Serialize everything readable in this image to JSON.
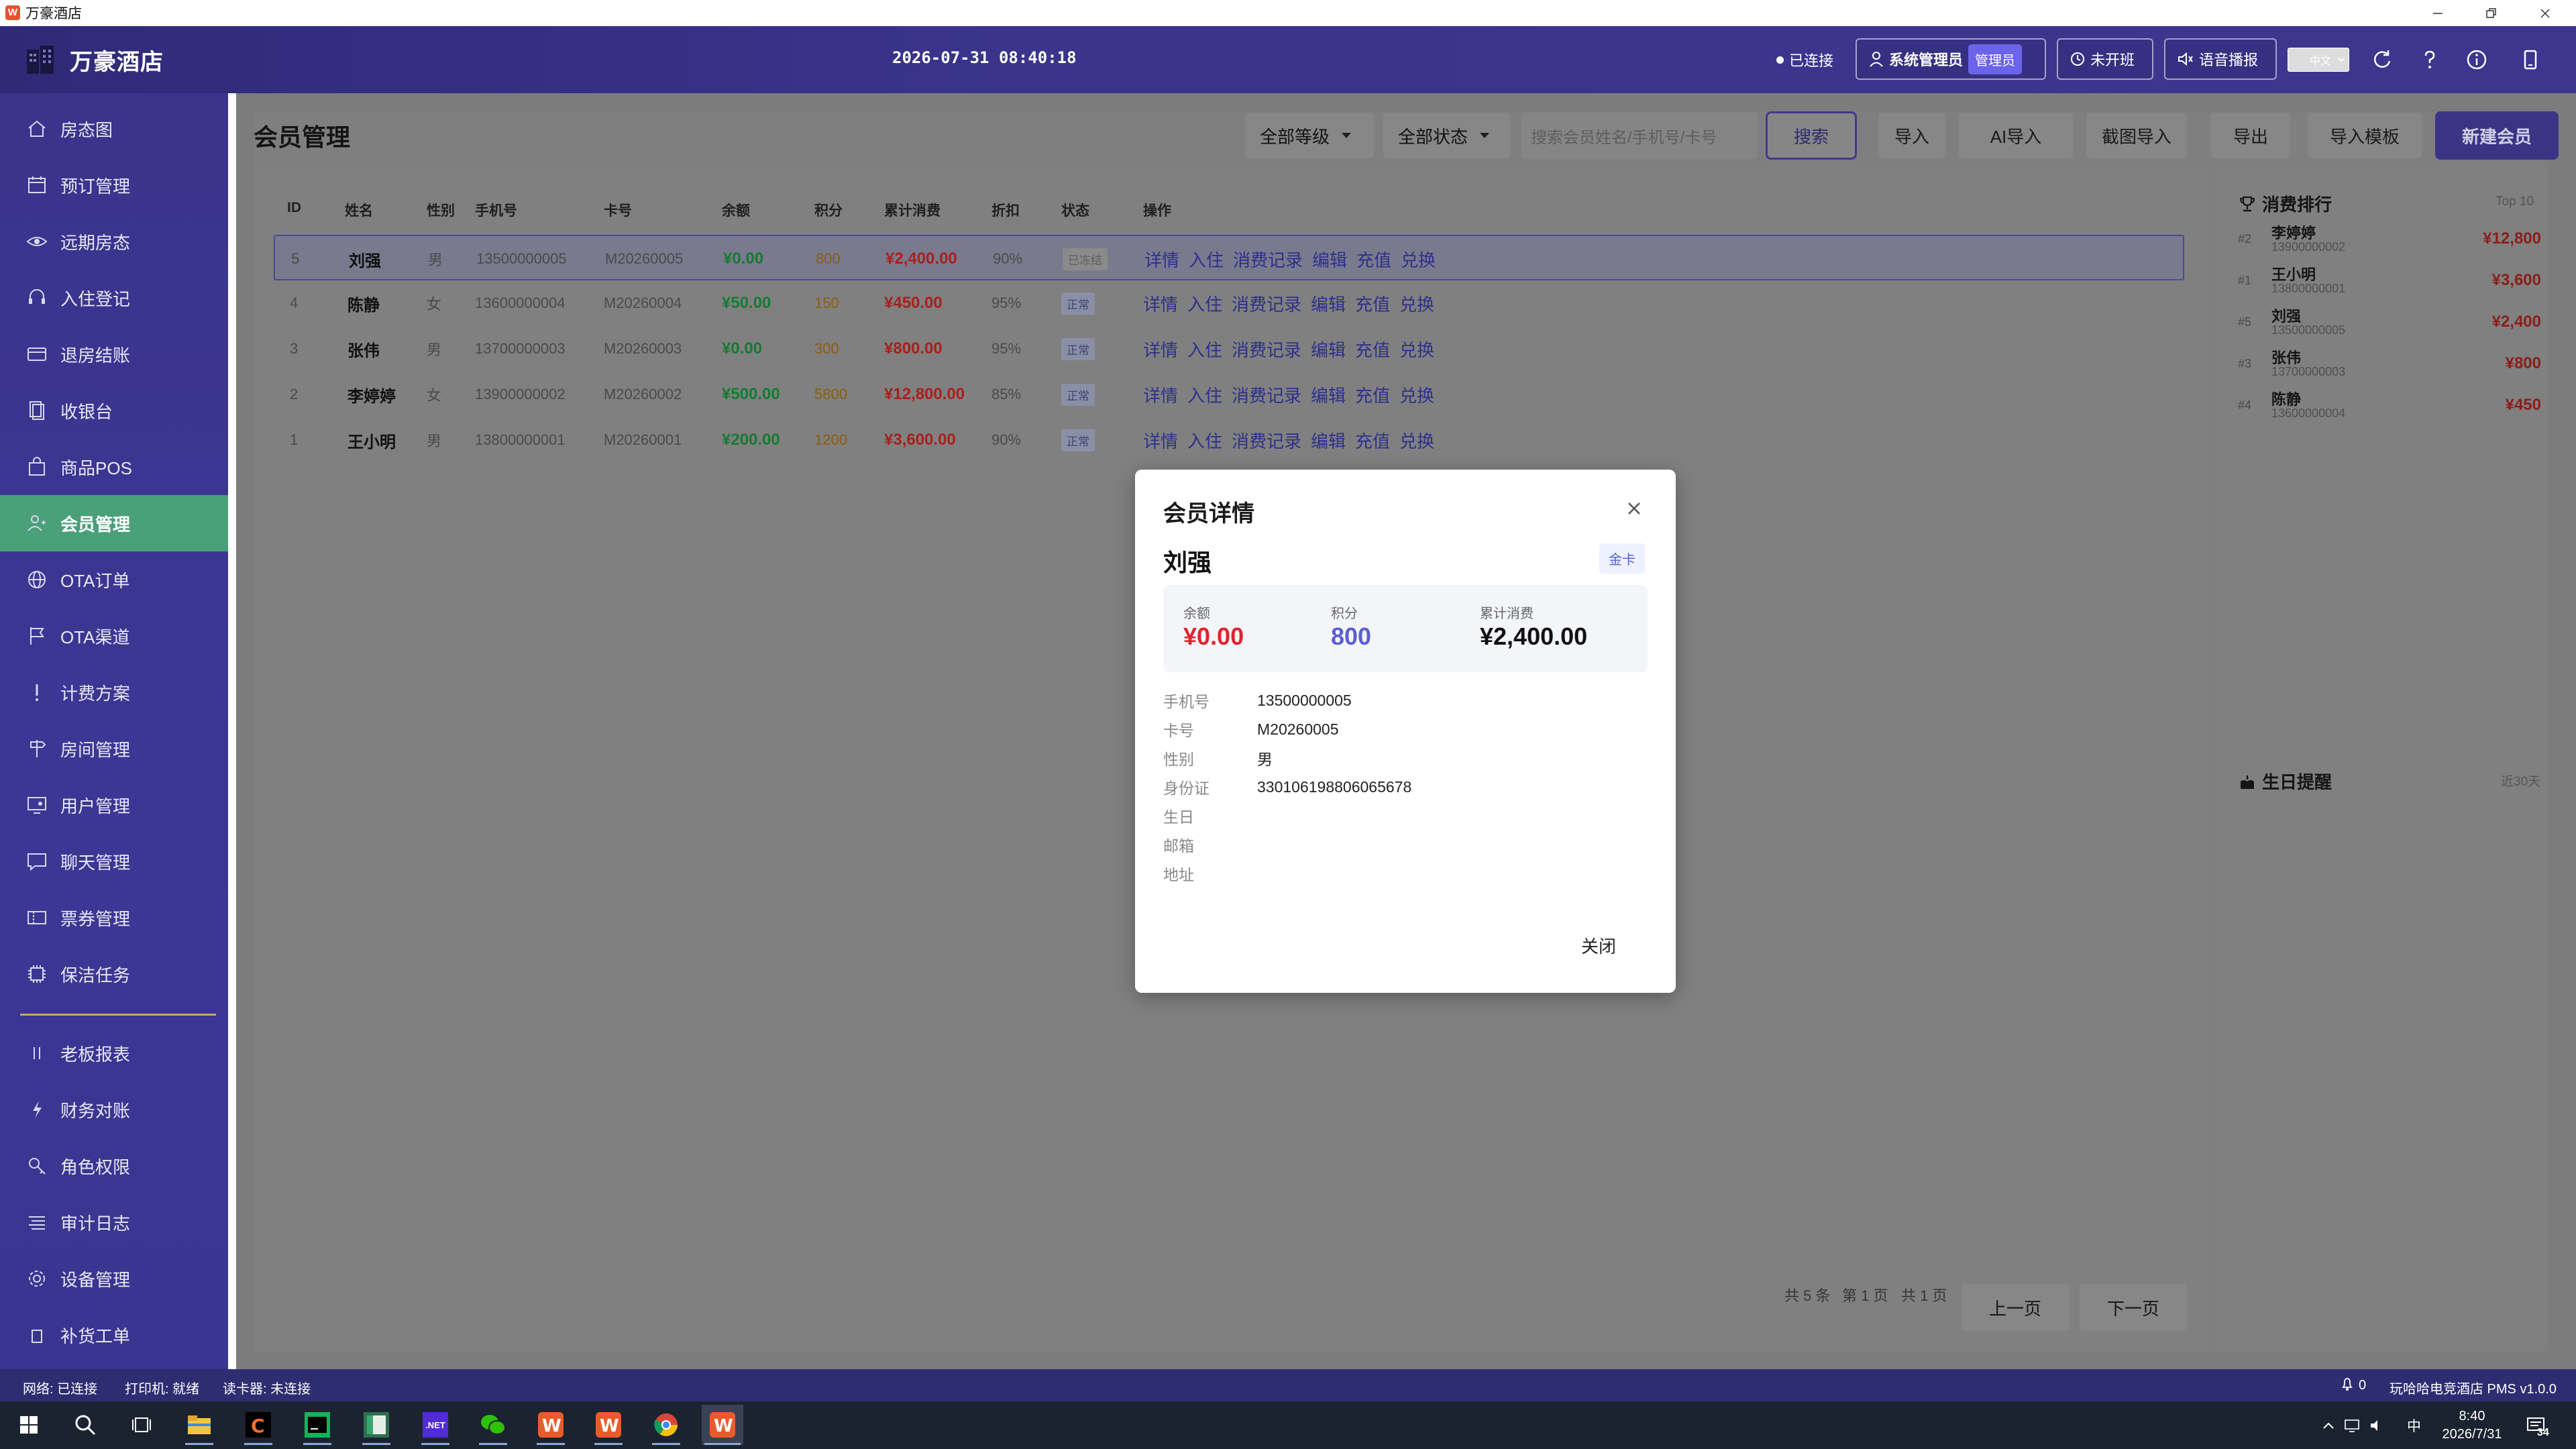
{
  "window": {
    "title": "万豪酒店"
  },
  "header": {
    "brand": "万豪酒店",
    "datetime": "2026-07-31 08:40:18",
    "connection": "已连接",
    "user_label": "系统管理员",
    "role_badge": "管理员",
    "shift_label": "未开班",
    "voice_label": "语音播报",
    "lang_value": "中文"
  },
  "sidebar": {
    "items": [
      {
        "label": "房态图",
        "icon": "home-icon"
      },
      {
        "label": "预订管理",
        "icon": "calendar-icon"
      },
      {
        "label": "远期房态",
        "icon": "eye-icon"
      },
      {
        "label": "入住登记",
        "icon": "headset-icon"
      },
      {
        "label": "退房结账",
        "icon": "card-icon"
      },
      {
        "label": "收银台",
        "icon": "cashier-icon"
      },
      {
        "label": "商品POS",
        "icon": "bag-icon"
      },
      {
        "label": "会员管理",
        "icon": "members-icon"
      },
      {
        "label": "OTA订单",
        "icon": "globe-icon"
      },
      {
        "label": "OTA渠道",
        "icon": "flag-icon"
      },
      {
        "label": "计费方案",
        "icon": "exclamation-icon"
      },
      {
        "label": "房间管理",
        "icon": "signpost-icon"
      },
      {
        "label": "用户管理",
        "icon": "monitor-user-icon"
      },
      {
        "label": "聊天管理",
        "icon": "chat-icon"
      },
      {
        "label": "票券管理",
        "icon": "ticket-icon"
      },
      {
        "label": "保洁任务",
        "icon": "chip-icon"
      },
      {
        "label": "老板报表",
        "icon": "bars-icon"
      },
      {
        "label": "财务对账",
        "icon": "lightning-icon"
      },
      {
        "label": "角色权限",
        "icon": "key-icon"
      },
      {
        "label": "审计日志",
        "icon": "list-icon"
      },
      {
        "label": "设备管理",
        "icon": "gear-icon"
      },
      {
        "label": "补货工单",
        "icon": "box-icon"
      }
    ],
    "active_index": 7
  },
  "page": {
    "title": "会员管理",
    "level_filter": "全部等级",
    "status_filter": "全部状态",
    "search_placeholder": "搜索会员姓名/手机号/卡号",
    "search_button": "搜索",
    "import_button": "导入",
    "ai_import_button": "AI导入",
    "screenshot_import_button": "截图导入",
    "export_button": "导出",
    "template_button": "导入模板",
    "new_button": "新建会员"
  },
  "table": {
    "headers": [
      "ID",
      "姓名",
      "性别",
      "手机号",
      "卡号",
      "余额",
      "积分",
      "累计消费",
      "折扣",
      "状态",
      "操作"
    ],
    "actions": [
      "详情",
      "入住",
      "消费记录",
      "编辑",
      "充值",
      "兑换"
    ],
    "rows": [
      {
        "id": "5",
        "name": "刘强",
        "gender": "男",
        "phone": "13500000005",
        "card": "M20260005",
        "balance": "¥0.00",
        "points": "800",
        "total": "¥2,400.00",
        "discount": "90%",
        "status": "已冻结"
      },
      {
        "id": "4",
        "name": "陈静",
        "gender": "女",
        "phone": "13600000004",
        "card": "M20260004",
        "balance": "¥50.00",
        "points": "150",
        "total": "¥450.00",
        "discount": "95%",
        "status": "正常"
      },
      {
        "id": "3",
        "name": "张伟",
        "gender": "男",
        "phone": "13700000003",
        "card": "M20260003",
        "balance": "¥0.00",
        "points": "300",
        "total": "¥800.00",
        "discount": "95%",
        "status": "正常"
      },
      {
        "id": "2",
        "name": "李婷婷",
        "gender": "女",
        "phone": "13900000002",
        "card": "M20260002",
        "balance": "¥500.00",
        "points": "5800",
        "total": "¥12,800.00",
        "discount": "85%",
        "status": "正常"
      },
      {
        "id": "1",
        "name": "王小明",
        "gender": "男",
        "phone": "13800000001",
        "card": "M20260001",
        "balance": "¥200.00",
        "points": "1200",
        "total": "¥3,600.00",
        "discount": "90%",
        "status": "正常"
      }
    ]
  },
  "pagination": {
    "total": "共 5 条",
    "page": "第 1 页",
    "pages": "共 1 页",
    "prev": "上一页",
    "next": "下一页"
  },
  "ranking": {
    "title": "消费排行",
    "top_label": "Top 10",
    "items": [
      {
        "rank": "#2",
        "name": "李婷婷",
        "phone": "13900000002",
        "amount": "¥12,800"
      },
      {
        "rank": "#1",
        "name": "王小明",
        "phone": "13800000001",
        "amount": "¥3,600"
      },
      {
        "rank": "#5",
        "name": "刘强",
        "phone": "13500000005",
        "amount": "¥2,400"
      },
      {
        "rank": "#3",
        "name": "张伟",
        "phone": "13700000003",
        "amount": "¥800"
      },
      {
        "rank": "#4",
        "name": "陈静",
        "phone": "13600000004",
        "amount": "¥450"
      }
    ]
  },
  "birthday": {
    "title": "生日提醒",
    "range": "近30天"
  },
  "modal": {
    "title": "会员详情",
    "name": "刘强",
    "level": "金卡",
    "stats": [
      {
        "label": "余额",
        "value": "¥0.00",
        "color": "#e0232f"
      },
      {
        "label": "积分",
        "value": "800",
        "color": "#5a5fd1"
      },
      {
        "label": "累计消费",
        "value": "¥2,400.00",
        "color": "#111111"
      }
    ],
    "fields": [
      {
        "label": "手机号",
        "value": "13500000005"
      },
      {
        "label": "卡号",
        "value": "M20260005"
      },
      {
        "label": "性别",
        "value": "男"
      },
      {
        "label": "身份证",
        "value": "330106198806065678"
      },
      {
        "label": "生日",
        "value": ""
      },
      {
        "label": "邮箱",
        "value": ""
      },
      {
        "label": "地址",
        "value": ""
      }
    ],
    "close_button": "关闭"
  },
  "statusbar": {
    "network": "网络: 已连接",
    "printer": "打印机: 就绪",
    "card_reader": "读卡器: 未连接",
    "notifications": "0",
    "version": "玩哈哈电竞酒店 PMS v1.0.0"
  },
  "taskbar": {
    "time": "8:40",
    "date": "2026/7/31",
    "ime": "中",
    "notif_count": "34",
    "net_label": ".NET"
  }
}
